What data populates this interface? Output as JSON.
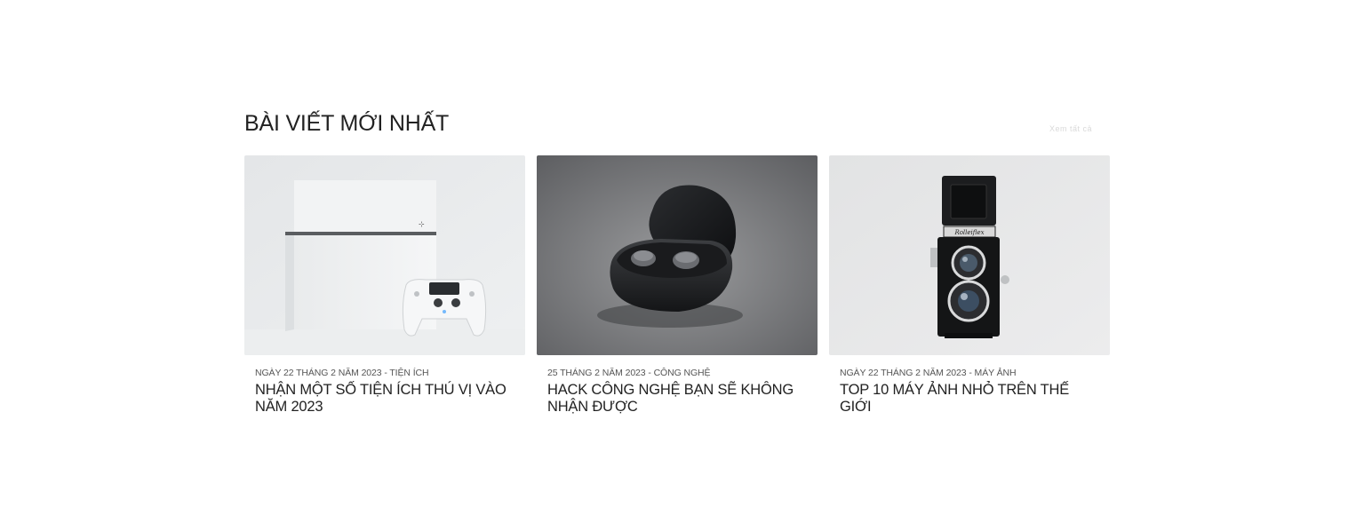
{
  "section": {
    "title": "BÀI VIẾT MỚI NHẤT",
    "see_all": "Xem tất cả"
  },
  "posts": [
    {
      "meta": "NGÀY 22 THÁNG 2 NĂM 2023 - TIỆN ÍCH",
      "title": "NHẬN MỘT SỐ TIỆN ÍCH THÚ VỊ VÀO NĂM 2023",
      "image_icon": "game-console-image"
    },
    {
      "meta": "25 THÁNG 2 NĂM 2023 - CÔNG NGHỆ",
      "title": "HACK CÔNG NGHỆ BẠN SẼ KHÔNG NHẬN ĐƯỢC",
      "image_icon": "earbuds-image"
    },
    {
      "meta": "NGÀY 22 THÁNG 2 NĂM 2023 - MÁY ẢNH",
      "title": "TOP 10 MÁY ẢNH NHỎ TRÊN THẾ GIỚI",
      "image_icon": "camera-image"
    }
  ],
  "colors": {
    "text": "#222222",
    "meta": "#555555",
    "background": "#ffffff"
  }
}
